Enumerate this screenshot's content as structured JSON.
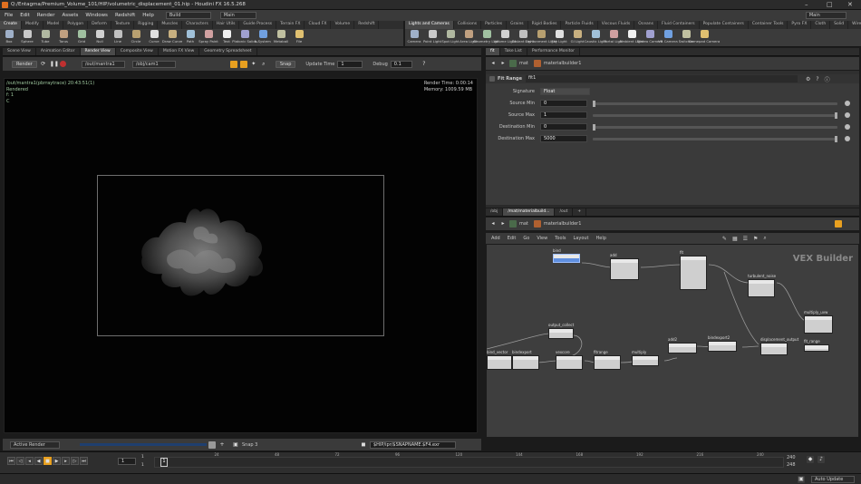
{
  "window": {
    "title": "Q:/Entagma/Premium_Volume_101/HIP/volumetric_displacement_01.hip - Houdini FX 16.5.268",
    "minimize": "–",
    "maximize": "□",
    "close": "✕"
  },
  "menubar": {
    "items": [
      "File",
      "Edit",
      "Render",
      "Assets",
      "Windows",
      "Redshift",
      "Help"
    ],
    "desktop": "Build",
    "context": "Main"
  },
  "left_shelf": {
    "tabs": [
      "Create",
      "Modify",
      "Model",
      "Polygon",
      "Deform",
      "Texture",
      "Rigging",
      "Muscles",
      "Characters",
      "Hair Utils",
      "Guide Process",
      "Terrain FX",
      "Cloud FX",
      "Volume",
      "Redshift"
    ],
    "tools": [
      "Box",
      "Sphere",
      "Tube",
      "Torus",
      "Grid",
      "Null",
      "Line",
      "Circle",
      "Curve",
      "Draw Curve",
      "Path",
      "Spray Paint",
      "Text",
      "Platonic Solids",
      "L-System",
      "Metaball",
      "File"
    ]
  },
  "right_shelf": {
    "tabs": [
      "Lights and Cameras",
      "Collisions",
      "Particles",
      "Grains",
      "Rigid Bodies",
      "Particle Fluids",
      "Viscous Fluids",
      "Oceans",
      "Fluid Containers",
      "Populate Containers",
      "Container Tools",
      "Pyro FX",
      "Cloth",
      "Solid",
      "Wires",
      "Crowds",
      "Drive Simulation"
    ],
    "tools": [
      "Camera",
      "Point Light",
      "Spot Light",
      "Area Light",
      "Geometry Light",
      "Volume Light",
      "Distant Light",
      "Environment Light",
      "Sky Light",
      "GI Light",
      "Caustic Light",
      "Portal Light",
      "Ambient Light",
      "Stereo Camera",
      "VR Camera",
      "Switcher",
      "Gamepad Camera"
    ]
  },
  "left_pane": {
    "tabs": [
      "Scene View",
      "Animation Editor",
      "Render View",
      "Composite View",
      "Motion FX View",
      "Geometry Spreadsheet"
    ],
    "toolbar": {
      "render_button": "Render",
      "rop": "/out/mantra1",
      "camera": "/obj/cam1",
      "snap": "Snap",
      "update_time_label": "Update Time",
      "update_time_value": "1",
      "debug_label": "Debug",
      "debug_value": "0.1"
    },
    "overlay_left": [
      "/out/mantra1(pbrraytrace) 20:43:51(1)",
      "Rendered",
      "f: 1",
      "C"
    ],
    "overlay_right": [
      "Render Time: 0:00:14",
      "Memory: 1009.59 MB"
    ],
    "bottom": {
      "snapshot": "Active Render",
      "snap_label": "Snap 3",
      "output": "$HIP/ipr/$SNAPNAME.$F4.exr"
    }
  },
  "param_pane": {
    "tabs": [
      "fit",
      "Take List",
      "Performance Monitor"
    ],
    "path": "mat",
    "node": "materialbuilder1",
    "header_type": "Fit Range",
    "header_name": "fit1",
    "params": [
      {
        "label": "Signature",
        "value": "Float",
        "fill": 0
      },
      {
        "label": "Source Min",
        "value": "0",
        "fill": 0.0
      },
      {
        "label": "Source Max",
        "value": "1",
        "fill": 1.0
      },
      {
        "label": "Destination Min",
        "value": "0",
        "fill": 0.0
      },
      {
        "label": "Destination Max",
        "value": "5000",
        "fill": 1.0
      }
    ]
  },
  "network": {
    "tabs": [
      "/obj",
      "/mat/materialbuild...",
      "/out"
    ],
    "path": "mat",
    "node": "materialbuilder1",
    "menu": [
      "Add",
      "Edit",
      "Go",
      "View",
      "Tools",
      "Layout",
      "Help"
    ],
    "watermark": "VEX Builder",
    "nodes": [
      "bind",
      "add",
      "fit",
      "turbulent_noise",
      "multiply_uvw",
      "output_collect",
      "bind_vector",
      "bindexport",
      "vexcore",
      "fitrange",
      "multiply",
      "add2",
      "bindexport2",
      "displacement_output",
      "fit_range"
    ]
  },
  "playbar": {
    "start": "1",
    "end": "1",
    "frame": "1",
    "current": "1",
    "ticks": [
      "24",
      "48",
      "72",
      "96",
      "120",
      "144",
      "168",
      "192",
      "216",
      "240"
    ],
    "range_end": "240",
    "range_end2": "248"
  },
  "statusbar": {
    "update_mode": "Auto Update"
  },
  "colors": {
    "accent": "#e8a020",
    "selected_node": "#5f8fe0",
    "render_text": "#9fc89f"
  }
}
